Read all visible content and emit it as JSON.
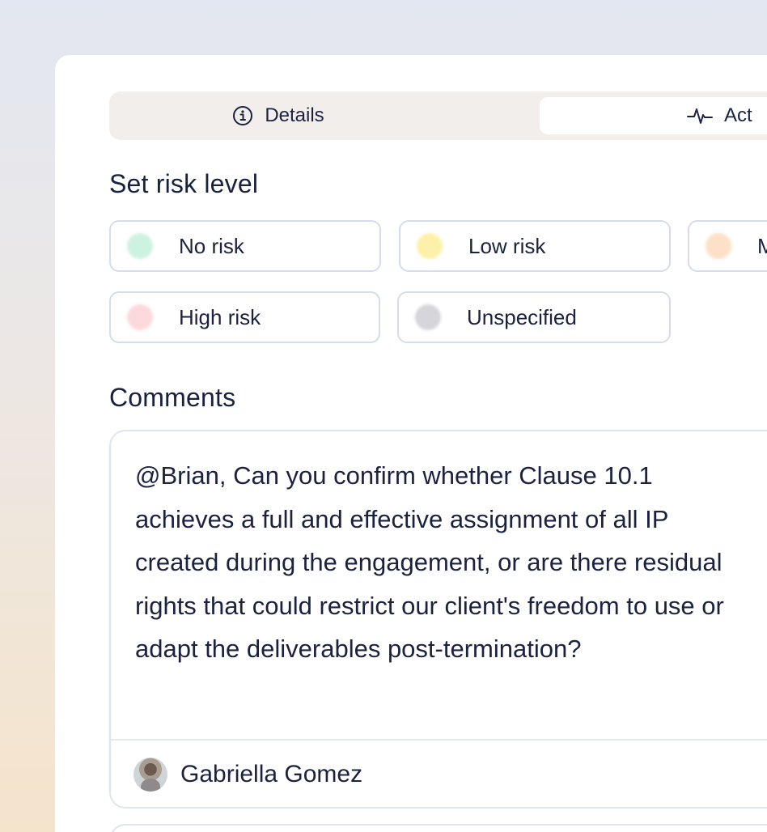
{
  "tabs": {
    "details": {
      "label": "Details",
      "icon": "info-icon"
    },
    "activity": {
      "label": "Act",
      "icon": "pulse-icon"
    }
  },
  "risk": {
    "title": "Set risk level",
    "options": [
      {
        "label": "No risk",
        "color": "#cdf2e2"
      },
      {
        "label": "Low risk",
        "color": "#fdf1a9"
      },
      {
        "label": "M",
        "color": "#fde0c8"
      },
      {
        "label": "High risk",
        "color": "#fcd9dc"
      },
      {
        "label": "Unspecified",
        "color": "#d6d6da"
      }
    ]
  },
  "comments": {
    "title": "Comments",
    "items": [
      {
        "text": "@Brian, Can you confirm whether Clause 10.1 achieves a full and effective assignment of all IP created during the engagement, or are there residual rights that could restrict our client's freedom to use or adapt the deliverables post-termination?",
        "author": "Gabriella Gomez"
      }
    ]
  }
}
